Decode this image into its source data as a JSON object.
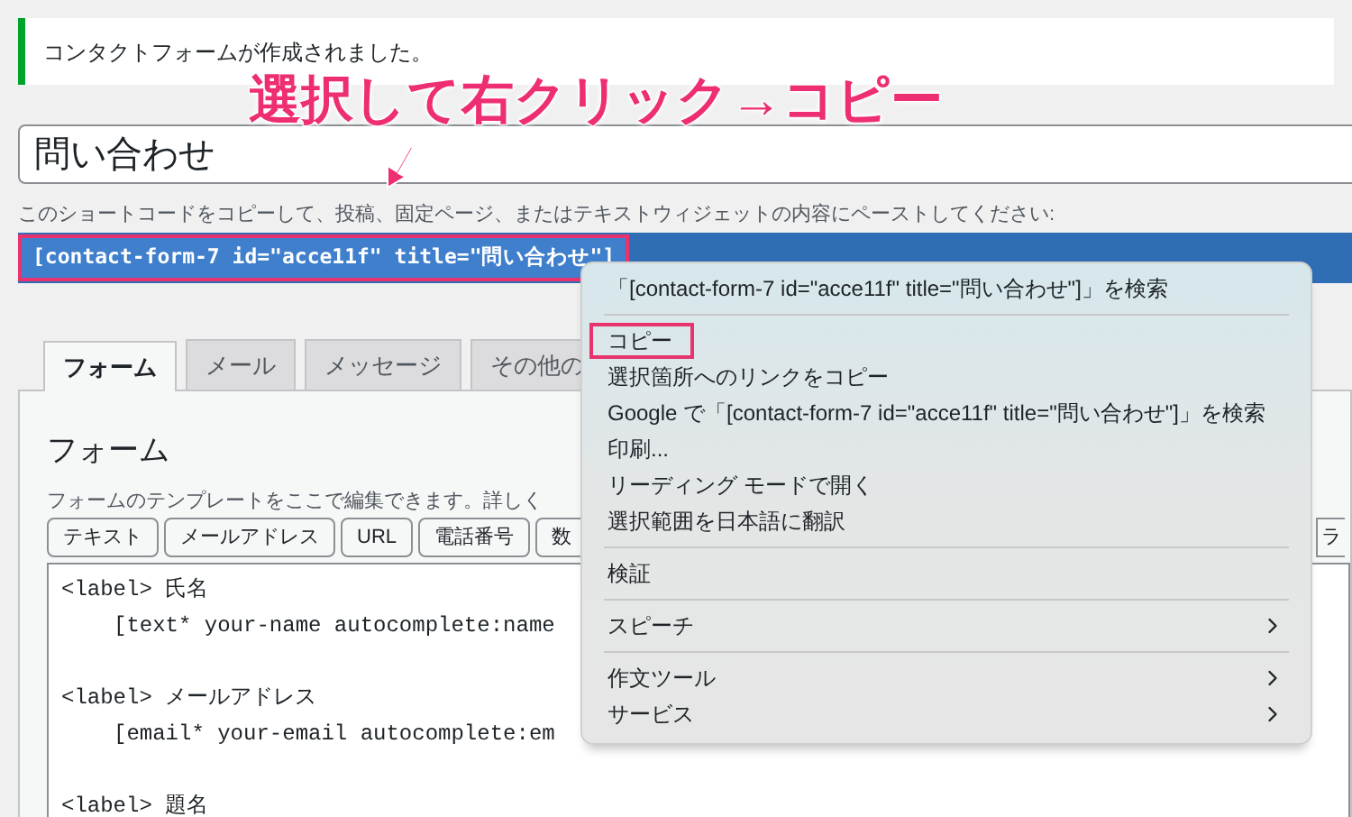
{
  "notice": {
    "text": "コンタクトフォームが作成されました。"
  },
  "annotation": {
    "text": "選択して右クリック→コピー"
  },
  "title_field": {
    "value": "問い合わせ"
  },
  "shortcode_hint": "このショートコードをコピーして、投稿、固定ページ、またはテキストウィジェットの内容にペーストしてください:",
  "shortcode": {
    "text": "[contact-form-7 id=\"acce11f\" title=\"問い合わせ\"]",
    "selected": true,
    "highlighted": true
  },
  "tabs": [
    {
      "label": "フォーム",
      "selected": true
    },
    {
      "label": "メール",
      "selected": false
    },
    {
      "label": "メッセージ",
      "selected": false
    },
    {
      "label": "その他の",
      "selected": false
    }
  ],
  "panel": {
    "heading": "フォーム",
    "description": "フォームのテンプレートをここで編集できます。詳しく",
    "tag_buttons": [
      "テキスト",
      "メールアドレス",
      "URL",
      "電話番号",
      "数"
    ],
    "tag_button_edge": "ラ",
    "code_blocks": [
      {
        "label": "<label> 氏名",
        "tag": "[text* your-name autocomplete:name"
      },
      {
        "label": "<label> メールアドレス",
        "tag": "[email* your-email autocomplete:em"
      },
      {
        "label": "<label> 題名"
      }
    ]
  },
  "context_menu": {
    "groups": [
      [
        {
          "label": "「[contact-form-7 id=\"acce11f\" title=\"問い合わせ\"]」を検索",
          "highlighted": false,
          "submenu": false
        }
      ],
      [
        {
          "label": "コピー",
          "highlighted": true,
          "submenu": false
        },
        {
          "label": "選択箇所へのリンクをコピー",
          "highlighted": false,
          "submenu": false
        },
        {
          "label": "Google で「[contact-form-7 id=\"acce11f\" title=\"問い合わせ\"]」を検索",
          "highlighted": false,
          "submenu": false
        },
        {
          "label": "印刷...",
          "highlighted": false,
          "submenu": false
        },
        {
          "label": "リーディング モードで開く",
          "highlighted": false,
          "submenu": false
        },
        {
          "label": "選択範囲を日本語に翻訳",
          "highlighted": false,
          "submenu": false
        }
      ],
      [
        {
          "label": "検証",
          "highlighted": false,
          "submenu": false
        }
      ],
      [
        {
          "label": "スピーチ",
          "highlighted": false,
          "submenu": true
        }
      ],
      [
        {
          "label": "作文ツール",
          "highlighted": false,
          "submenu": true
        },
        {
          "label": "サービス",
          "highlighted": false,
          "submenu": true
        }
      ]
    ]
  }
}
